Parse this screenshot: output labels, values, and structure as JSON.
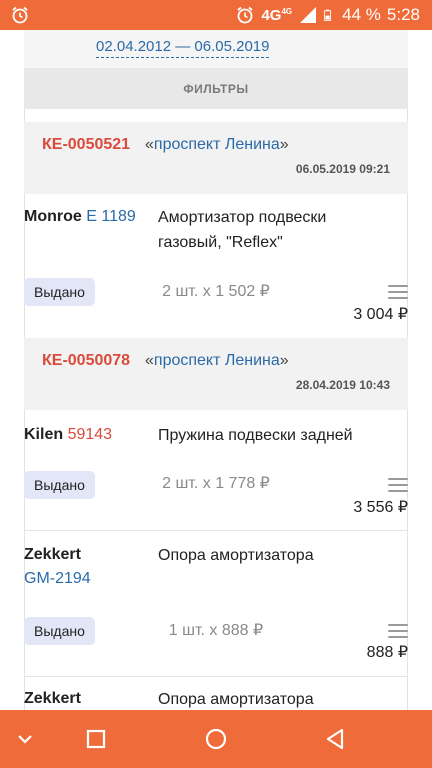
{
  "status_bar": {
    "network": "4G",
    "network_small": "4G",
    "battery": "44 %",
    "time": "5:28",
    "icons": [
      "alarm-icon",
      "alarm-icon",
      "signal-icon",
      "battery-icon"
    ]
  },
  "filters": {
    "date_range": "02.04.2012 — 06.05.2019",
    "button_label": "ФИЛЬТРЫ"
  },
  "orders": [
    {
      "id": "КЕ-0050521",
      "store_open": "«",
      "store": "проспект Ленина",
      "store_close": "»",
      "date": "06.05.2019 09:21",
      "items": [
        {
          "brand": "Monroe",
          "code": "E 1189",
          "description": "Амортизатор подвески газовый, \"Reflex\"",
          "status": "Выдано",
          "qty_price": "2 шт. x 1 502 ₽",
          "total": "3 004 ₽"
        }
      ]
    },
    {
      "id": "КЕ-0050078",
      "store_open": "«",
      "store": "проспект Ленина",
      "store_close": "»",
      "date": "28.04.2019 10:43",
      "items": [
        {
          "brand": "Kilen",
          "code": "59143",
          "description": "Пружина подвески задней",
          "status": "Выдано",
          "qty_price": "2 шт. x 1 778 ₽",
          "total": "3 556 ₽"
        },
        {
          "brand": "Zekkert",
          "code": "GM-2194",
          "description": "Опора амортизатора",
          "status": "Выдано",
          "qty_price": "1 шт. x 888 ₽",
          "total": "888 ₽"
        },
        {
          "brand": "Zekkert",
          "description": "Опора амортизатора"
        }
      ]
    }
  ],
  "nav_bar": {
    "icons": [
      "chevron-down-icon",
      "recents-icon",
      "home-icon",
      "back-icon"
    ]
  }
}
